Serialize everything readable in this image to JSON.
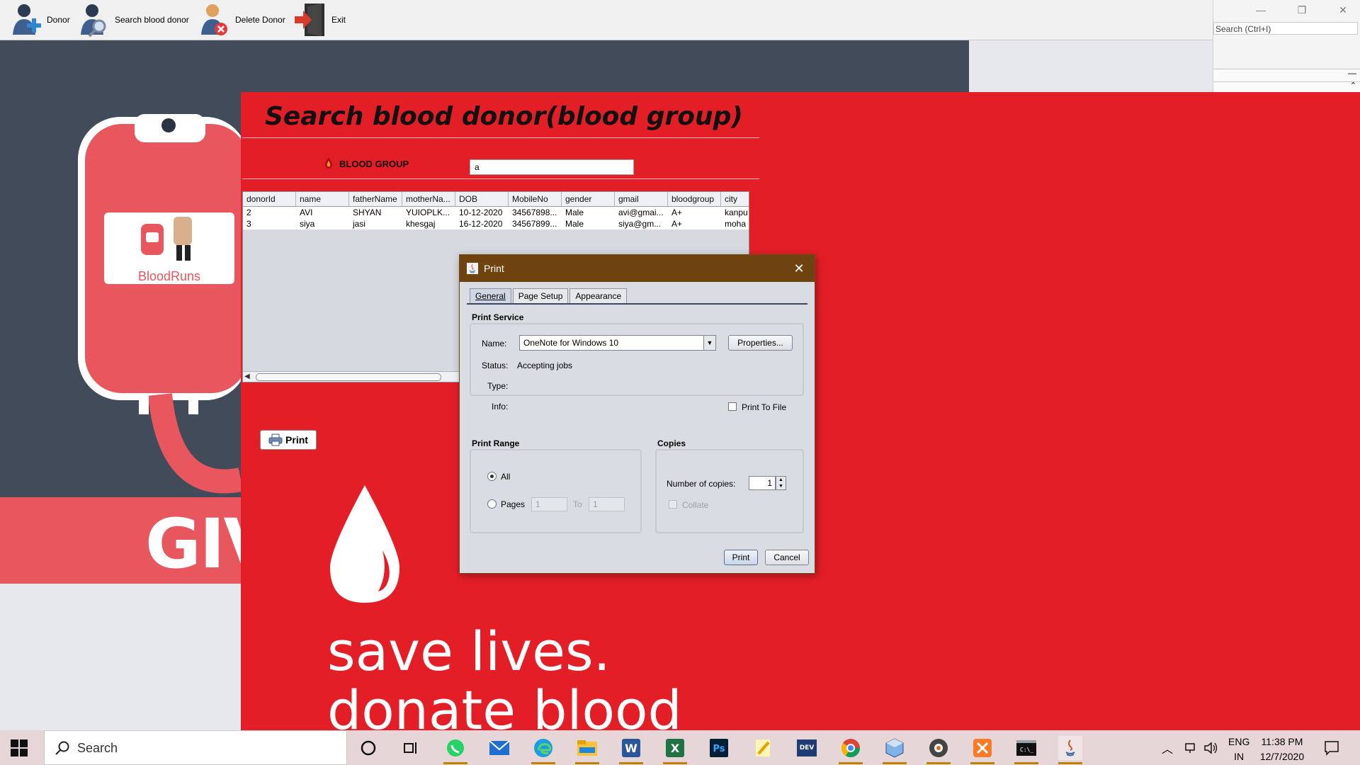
{
  "toolbar": {
    "items": [
      {
        "label": "Donor",
        "icon": "add-donor-icon"
      },
      {
        "label": "Search blood donor",
        "icon": "search-donor-icon"
      },
      {
        "label": "Delete Donor",
        "icon": "delete-donor-icon"
      },
      {
        "label": "Exit",
        "icon": "exit-icon"
      }
    ]
  },
  "ide": {
    "search_placeholder": "Search (Ctrl+I)"
  },
  "poster": {
    "brand": "BloodRuns",
    "give_text": "GIV",
    "tagline_1": "save lives.",
    "tagline_2": "donate blood"
  },
  "form": {
    "title": "Search blood donor(blood group)",
    "blood_group_label": "BLOOD GROUP",
    "blood_group_value": "a",
    "print_button": "Print",
    "table": {
      "columns": [
        "donorId",
        "name",
        "fatherName",
        "motherNa...",
        "DOB",
        "MobileNo",
        "gender",
        "gmail",
        "bloodgroup",
        "city"
      ],
      "rows": [
        [
          "2",
          "AVI",
          "SHYAN",
          "YUIOPLK...",
          "10-12-2020",
          "34567898...",
          "Male",
          "avi@gmai...",
          "A+",
          "kanpu"
        ],
        [
          "3",
          "siya",
          "jasi",
          "khesgaj",
          "16-12-2020",
          "34567899...",
          "Male",
          "siya@gm...",
          "A+",
          "moha"
        ]
      ]
    }
  },
  "dialog": {
    "title": "Print",
    "tabs": [
      "General",
      "Page Setup",
      "Appearance"
    ],
    "active_tab": "General",
    "print_service": {
      "title": "Print Service",
      "name_label": "Name:",
      "name_value": "OneNote for Windows 10",
      "properties_button": "Properties...",
      "status_label": "Status:",
      "status_value": "Accepting jobs",
      "type_label": "Type:",
      "info_label": "Info:",
      "print_to_file_label": "Print To File"
    },
    "print_range": {
      "title": "Print Range",
      "all_label": "All",
      "pages_label": "Pages",
      "from_value": "1",
      "to_label": "To",
      "to_value": "1"
    },
    "copies": {
      "title": "Copies",
      "number_label": "Number of copies:",
      "number_value": "1",
      "collate_label": "Collate"
    },
    "print_button": "Print",
    "cancel_button": "Cancel"
  },
  "taskbar": {
    "search_text": "Search",
    "apps": [
      "cortana-icon",
      "task-view-icon",
      "whatsapp-icon",
      "mail-icon",
      "edge-icon",
      "file-explorer-icon",
      "word-icon",
      "excel-icon",
      "photoshop-icon",
      "notes-icon",
      "dev-cpp-icon",
      "chrome-icon",
      "virtualbox-icon",
      "media-icon",
      "xampp-icon",
      "terminal-icon",
      "java-icon"
    ],
    "lang_1": "ENG",
    "lang_2": "IN",
    "time": "11:38 PM",
    "date": "12/7/2020"
  },
  "colors": {
    "panel_red": "#e41e26",
    "poster_dark": "#424b5a",
    "dialog_title": "#6f4310"
  }
}
